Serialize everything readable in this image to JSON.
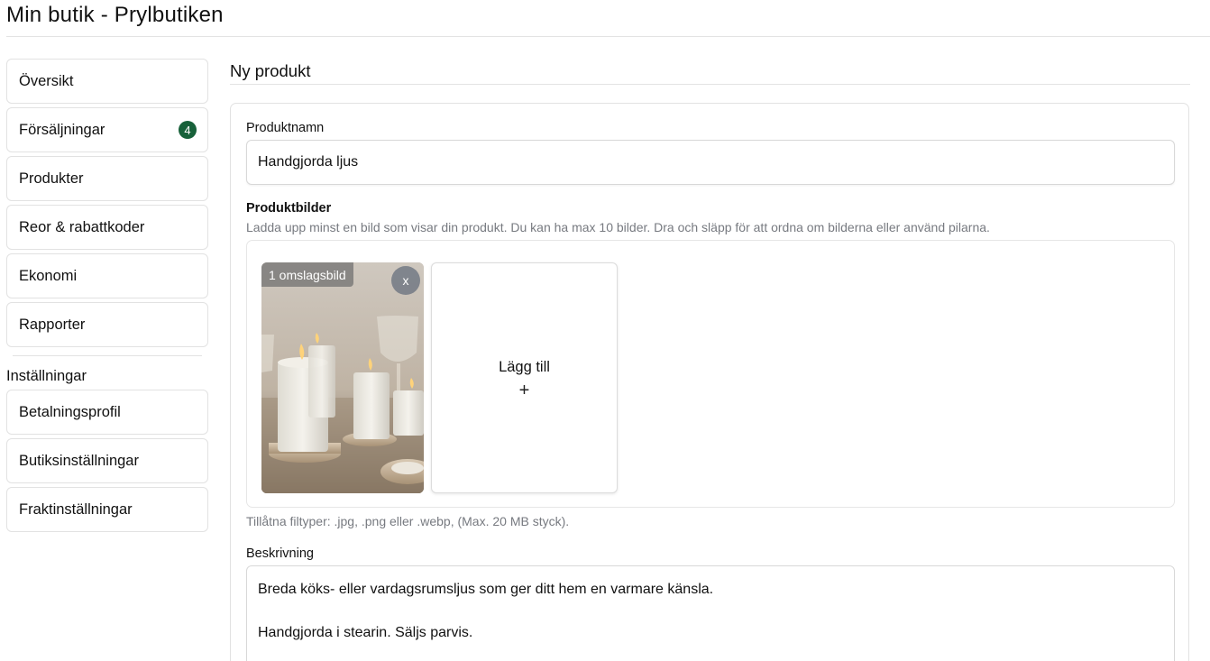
{
  "header": {
    "title": "Min butik - Prylbutiken"
  },
  "sidebar": {
    "items": [
      {
        "label": "Översikt"
      },
      {
        "label": "Försäljningar",
        "badge": "4"
      },
      {
        "label": "Produkter"
      },
      {
        "label": "Reor & rabattkoder"
      },
      {
        "label": "Ekonomi"
      },
      {
        "label": "Rapporter"
      }
    ],
    "settings_heading": "Inställningar",
    "settings_items": [
      {
        "label": "Betalningsprofil"
      },
      {
        "label": "Butiksinställningar"
      },
      {
        "label": "Fraktinställningar"
      }
    ]
  },
  "main": {
    "title": "Ny produkt",
    "product_name": {
      "label": "Produktnamn",
      "value": "Handgjorda ljus"
    },
    "images": {
      "title": "Produktbilder",
      "help": "Ladda upp minst en bild som visar din produkt. Du kan ha max 10 bilder. Dra och släpp för att ordna om bilderna eller använd pilarna.",
      "cover_tag": "1 omslagsbild",
      "remove_label": "x",
      "add_label": "Lägg till",
      "add_icon": "+",
      "file_types": "Tillåtna filtyper: .jpg, .png eller .webp, (Max. 20 MB styck)."
    },
    "description": {
      "label": "Beskrivning",
      "value": "Breda köks- eller vardagsrumsljus som ger ditt hem en varmare känsla.\n\nHandgjorda i stearin. Säljs parvis."
    }
  },
  "colors": {
    "badge": "#17613a",
    "border": "#e2e2e2",
    "muted_text": "#777a80"
  }
}
